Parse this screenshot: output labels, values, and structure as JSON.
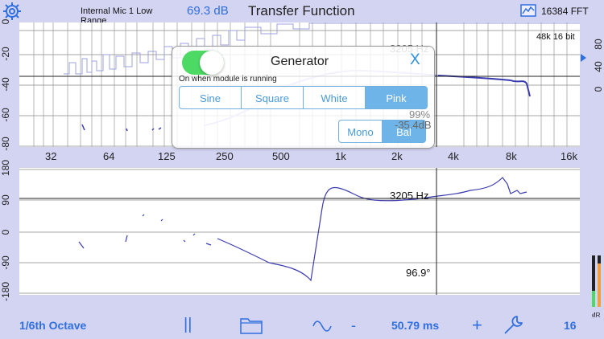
{
  "header": {
    "input_label": "Internal Mic 1 Low Range",
    "level": "69.3 dB",
    "title": "Transfer Function",
    "fft_size": "16384 FFT",
    "icons": {
      "settings": "gear-icon",
      "fft": "spectrum-icon"
    }
  },
  "magnitude_plot": {
    "y_ticks": [
      "0",
      "-20",
      "-40",
      "-60",
      "-80"
    ],
    "right_ticks_a": [
      "80",
      "40",
      "0"
    ],
    "freq_labels": [
      "32",
      "64",
      "125",
      "250",
      "500",
      "1k",
      "2k",
      "4k",
      "8k",
      "16k"
    ],
    "cursor_freq": "3205 Hz",
    "sample_info": "48k 16 bit",
    "coherence": "99%",
    "cursor_db": "-35.4dB"
  },
  "phase_plot": {
    "y_ticks": [
      "180",
      "90",
      "0",
      "-90",
      "-180"
    ],
    "cursor_freq": "3205 Hz",
    "cursor_phase": "96.9°"
  },
  "generator": {
    "title": "Generator",
    "close": "X",
    "subtitle": "On when module is running",
    "enabled": true,
    "signal_types": [
      "Sine",
      "Square",
      "White",
      "Pink"
    ],
    "selected_signal": "Pink",
    "channel_modes": [
      "Mono",
      "Bal"
    ],
    "selected_mode": "Bal"
  },
  "meter": {
    "label": "MR"
  },
  "toolbar": {
    "smoothing": "1/6th Octave",
    "pause": "||",
    "delay": "50.79 ms",
    "minus": "-",
    "plus": "+",
    "averages": "16"
  },
  "colors": {
    "accent": "#2f6fe0",
    "trace": "#3b3bb0",
    "toggle_on": "#4cd964",
    "background": "#d3d4f2"
  }
}
